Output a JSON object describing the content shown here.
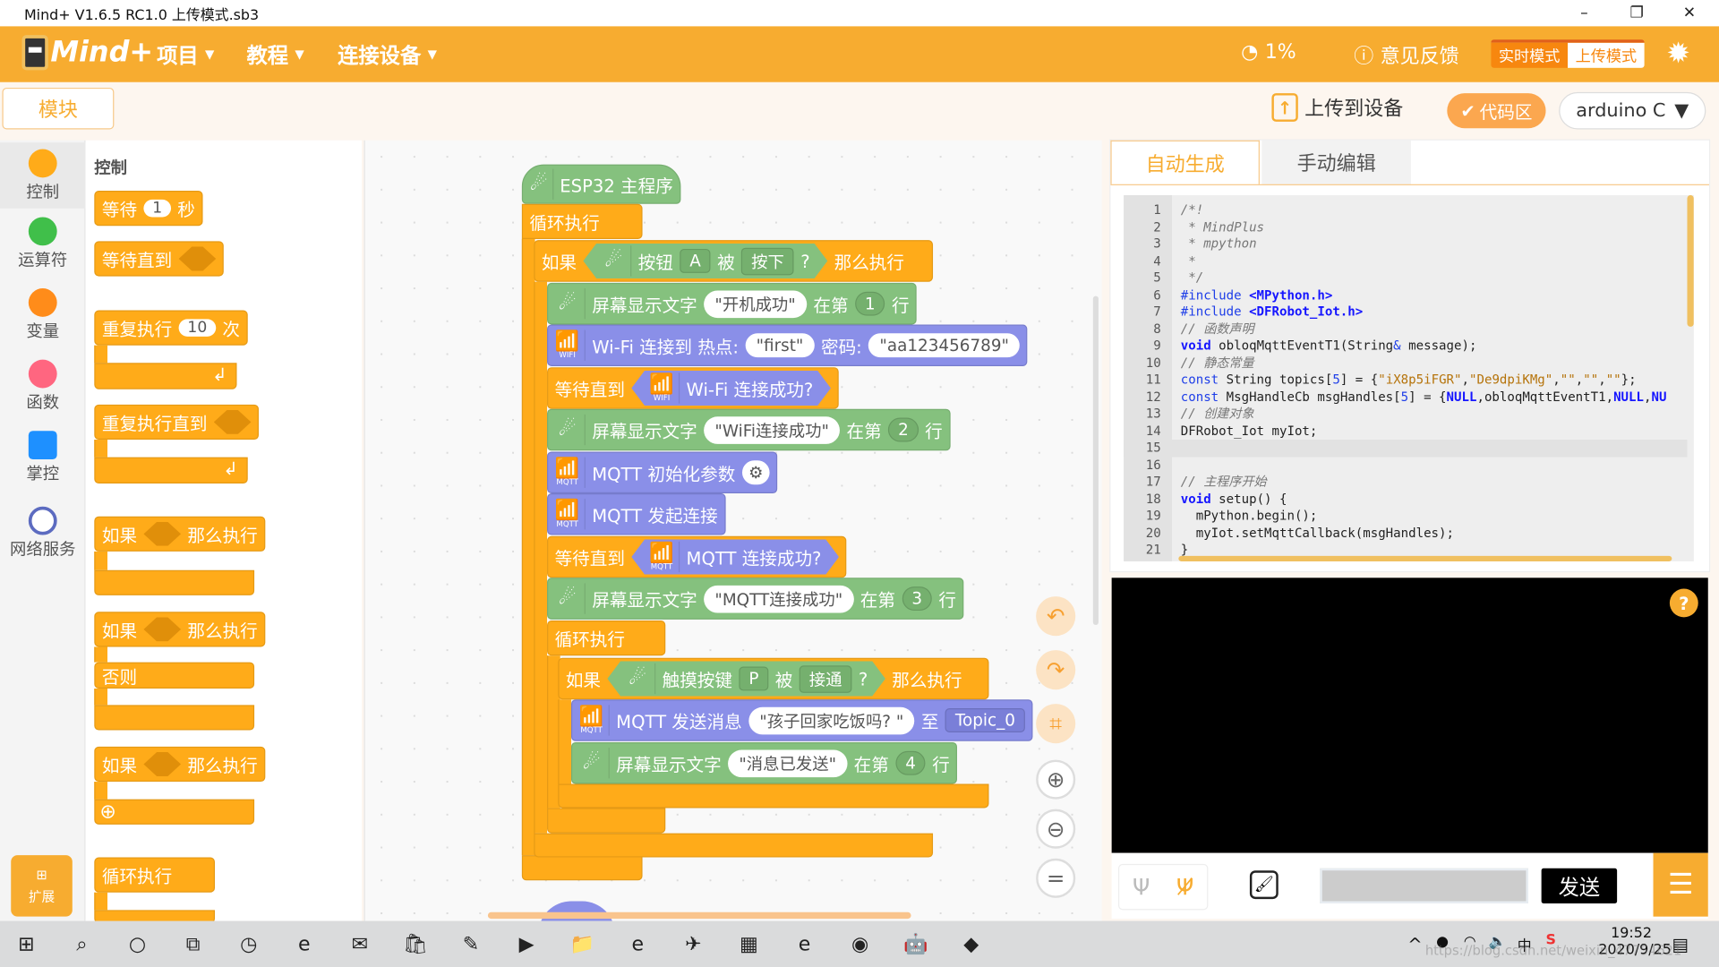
{
  "window": {
    "title": "Mind+ V1.6.5 RC1.0   上传模式.sb3",
    "minimize": "–",
    "maximize": "❐",
    "close": "✕"
  },
  "header": {
    "logo": "Mind+",
    "menus": [
      {
        "label": "项目"
      },
      {
        "label": "教程"
      },
      {
        "label": "连接设备"
      }
    ],
    "caret": "▼",
    "progress": "1%",
    "feedback": "意见反馈",
    "mode_realtime": "实时模式",
    "mode_upload": "上传模式",
    "active_mode": "上传模式",
    "accent": "#f7ac30"
  },
  "subbar": {
    "blocks_tab": "模块",
    "upload": "上传到设备",
    "code_area": "代码区",
    "board": "arduino C"
  },
  "categories": [
    {
      "label": "控制",
      "color": "#ffab19"
    },
    {
      "label": "运算符",
      "color": "#40bf4a"
    },
    {
      "label": "变量",
      "color": "#ff8c1a"
    },
    {
      "label": "函数",
      "color": "#ff6680"
    },
    {
      "label": "掌控",
      "color": "#1e90ff"
    },
    {
      "label": "网络服务",
      "color": "#5c6bc0"
    }
  ],
  "extension": "扩展",
  "palette": {
    "heading": "控制",
    "wait": "等待",
    "wait_num": "1",
    "wait_unit": "秒",
    "wait_until": "等待直到",
    "repeat": "重复执行",
    "repeat_num": "10",
    "repeat_unit": "次",
    "repeat_until": "重复执行直到",
    "if": "如果",
    "then": "那么执行",
    "else": "否则",
    "forever": "循环执行"
  },
  "script": {
    "hat": "ESP32 主程序",
    "forever": "循环执行",
    "if": "如果",
    "then": "那么执行",
    "button": "按钮",
    "button_val": "A",
    "by": "被",
    "pressed": "按下",
    "q": "?",
    "show_text": "屏幕显示文字",
    "at_line": "在第",
    "line_unit": "行",
    "show1": "\"开机成功\"",
    "line1": "1",
    "wifi_connect": "Wi-Fi 连接到 热点:",
    "ssid": "\"first\"",
    "pwd_label": "密码:",
    "pwd": "\"aa123456789\"",
    "wait_until": "等待直到",
    "wifi_ok": "Wi-Fi 连接成功?",
    "show2": "\"WiFi连接成功\"",
    "line2": "2",
    "mqtt_init": "MQTT 初始化参数",
    "mqtt_connect": "MQTT 发起连接",
    "mqtt_ok": "MQTT 连接成功?",
    "show3": "\"MQTT连接成功\"",
    "line3": "3",
    "touch": "触摸按键",
    "touch_val": "P",
    "touched": "接通",
    "mqtt_send": "MQTT 发送消息",
    "msg": "\"孩子回家吃饭吗?  \"",
    "to": "至",
    "topic": "Topic_0",
    "show4": "\"消息已发送\"",
    "line4": "4",
    "wifi_tag": "WIFI",
    "mqtt_tag": "MQTT"
  },
  "code": {
    "tab_auto": "自动生成",
    "tab_manual": "手动编辑",
    "current_line": 15,
    "lines": [
      [
        [
          "/*!",
          "cm"
        ]
      ],
      [
        [
          " * MindPlus",
          "cm"
        ]
      ],
      [
        [
          " * mpython",
          "cm"
        ]
      ],
      [
        [
          " *",
          "cm"
        ]
      ],
      [
        [
          " */",
          "cm"
        ]
      ],
      [
        [
          "#include ",
          "k"
        ],
        [
          "<MPython.h>",
          "b"
        ]
      ],
      [
        [
          "#include ",
          "k"
        ],
        [
          "<DFRobot_Iot.h>",
          "b"
        ]
      ],
      [
        [
          "// 函数声明",
          "cm"
        ]
      ],
      [
        [
          "void ",
          "b"
        ],
        [
          "obloqMqttEventT1(String",
          "tx"
        ],
        [
          "&",
          "k"
        ],
        [
          " message);",
          "tx"
        ]
      ],
      [
        [
          "// 静态常量",
          "cm"
        ]
      ],
      [
        [
          "const ",
          "k"
        ],
        [
          "String topics[",
          "tx"
        ],
        [
          "5",
          "n"
        ],
        [
          "] = {",
          "tx"
        ],
        [
          "\"iX8p5iFGR\"",
          "s"
        ],
        [
          ",",
          "tx"
        ],
        [
          "\"De9dpiKMg\"",
          "s"
        ],
        [
          ",",
          "tx"
        ],
        [
          "\"\"",
          "s"
        ],
        [
          ",",
          "tx"
        ],
        [
          "\"\"",
          "s"
        ],
        [
          ",",
          "tx"
        ],
        [
          "\"\"",
          "s"
        ],
        [
          "};",
          "tx"
        ]
      ],
      [
        [
          "const ",
          "k"
        ],
        [
          "MsgHandleCb msgHandles[",
          "tx"
        ],
        [
          "5",
          "n"
        ],
        [
          "] = {",
          "tx"
        ],
        [
          "NULL",
          "b"
        ],
        [
          ",obloqMqttEventT1,",
          "tx"
        ],
        [
          "NULL",
          "b"
        ],
        [
          ",",
          "tx"
        ],
        [
          "NU",
          "b"
        ]
      ],
      [
        [
          "// 创建对象",
          "cm"
        ]
      ],
      [
        [
          "DFRobot_Iot myIot;",
          "tx"
        ]
      ],
      [],
      [],
      [
        [
          "// 主程序开始",
          "cm"
        ]
      ],
      [
        [
          "void ",
          "b"
        ],
        [
          "setup() {",
          "tx"
        ]
      ],
      [
        [
          "  mPython.begin();",
          "tx"
        ]
      ],
      [
        [
          "  myIot.setMqttCallback(msgHandles);",
          "tx"
        ]
      ],
      [
        [
          "}",
          "tx"
        ]
      ],
      []
    ]
  },
  "serial": {
    "help": "?",
    "send": "发送",
    "input_value": ""
  },
  "taskbar": {
    "time": "19:52",
    "date": "2020/9/25",
    "ime": "中",
    "watermark": "https://blog.csdn.net/weixin_47754621",
    "apps": [
      "windows-start",
      "search",
      "cortana",
      "task-view",
      "clock",
      "edge",
      "mail",
      "store",
      "paint",
      "media-player",
      "file-explorer",
      "browser-360",
      "mail-app",
      "sheets",
      "edge-dev",
      "netease-music",
      "mindplus",
      "paint-3d"
    ]
  }
}
